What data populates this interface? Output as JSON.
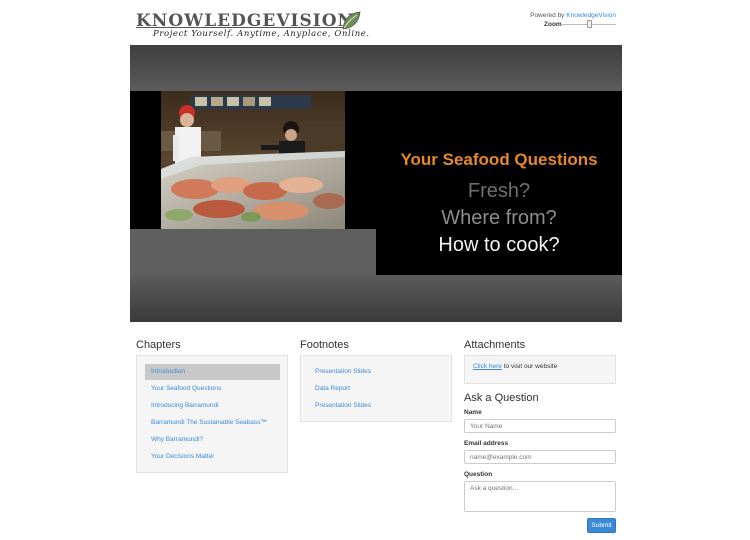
{
  "header": {
    "logo_text": "KNOWLEDGEVISION",
    "logo_tagline": "Project Yourself. Anytime, Anyplace, Online.",
    "powered_prefix": "Powered by ",
    "powered_link": "KnowledgeVision",
    "zoom_label": "Zoom",
    "zoom_level": 0.5
  },
  "slide": {
    "title": "Your Seafood Questions",
    "lines": [
      "Fresh?",
      "Where from?",
      "How to cook?"
    ]
  },
  "chapters": {
    "heading": "Chapters",
    "items": [
      "Introduction",
      "Your Seafood Questions",
      "Introducing Barramundi",
      "Barramundi The Sustainable Seabass™",
      "Why Barramundi?",
      "Your Decisions Matter"
    ],
    "active_index": 0
  },
  "footnotes": {
    "heading": "Footnotes",
    "items": [
      "Presentation Slides",
      "Data Report",
      "Presentation Slides"
    ]
  },
  "attachments": {
    "heading": "Attachments",
    "link_text": "Click here",
    "rest_text": " to visit our website"
  },
  "question": {
    "heading": "Ask a Question",
    "name_label": "Name",
    "name_placeholder": "Your Name",
    "email_label": "Email address",
    "email_placeholder": "name@example.com",
    "question_label": "Question",
    "question_placeholder": "Ask a question...",
    "submit_label": "Submit"
  },
  "colors": {
    "link": "#3a8ad6",
    "slide_title": "#e5882a",
    "active_item_bg": "#c8c8c8"
  }
}
